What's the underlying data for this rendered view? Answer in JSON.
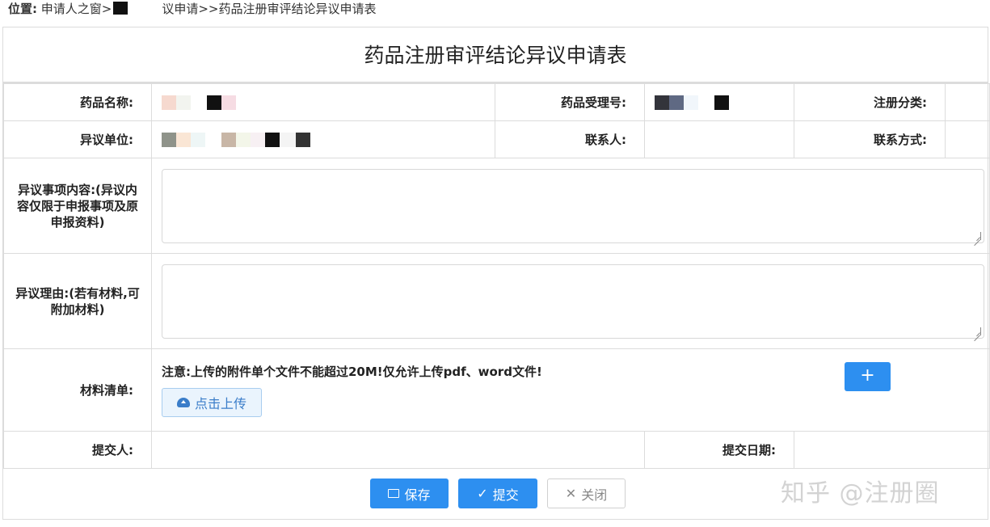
{
  "breadcrumb": {
    "label": "位置:",
    "part1": "申请人之窗>",
    "part2": "议申请>>药品注册审评结论异议申请表"
  },
  "form": {
    "title": "药品注册审评结论异议申请表",
    "fields": {
      "drug_name_label": "药品名称:",
      "acceptance_no_label": "药品受理号:",
      "reg_category_label": "注册分类:",
      "objection_unit_label": "异议单位:",
      "contact_label": "联系人:",
      "contact_method_label": "联系方式:",
      "objection_content_label": "异议事项内容:(异议内容仅限于申报事项及原申报资料)",
      "objection_reason_label": "异议理由:(若有材料,可附加材料)",
      "materials_label": "材料清单:",
      "submitter_label": "提交人:",
      "submit_date_label": "提交日期:"
    },
    "notice": "注意:上传的附件单个文件不能超过20M!仅允许上传pdf、word文件!",
    "upload_label": "点击上传",
    "add_label": "+"
  },
  "actions": {
    "save_label": "保存",
    "submit_label": "提交",
    "close_label": "关闭"
  },
  "watermark": "知乎 @注册圈",
  "colors": {
    "primary": "#2d8ff0",
    "border": "#dcdcdc",
    "upload_bg": "#eaf4fd"
  }
}
